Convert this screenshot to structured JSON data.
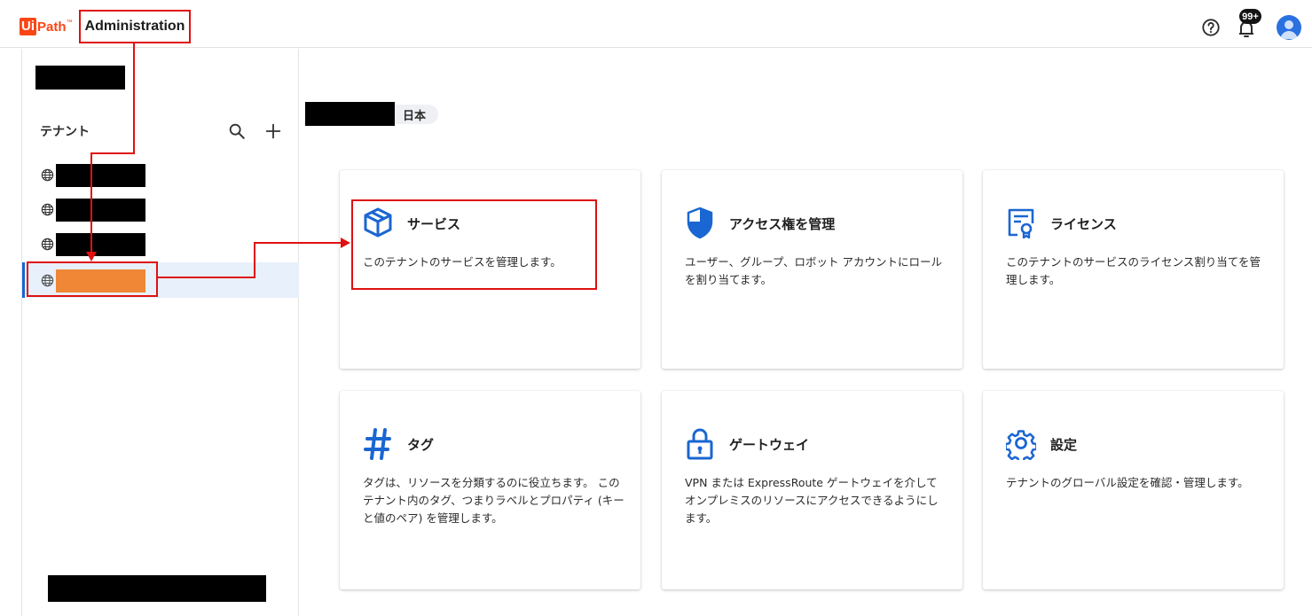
{
  "header": {
    "logo_ui": "Ui",
    "logo_path": "Path",
    "logo_mark": "™",
    "app_title": "Administration",
    "notification_badge": "99+"
  },
  "sidebar": {
    "heading": "テナント"
  },
  "main": {
    "region_label": "日本",
    "cards": [
      {
        "title": "サービス",
        "description": "このテナントのサービスを管理します。",
        "icon": "cube-icon"
      },
      {
        "title": "アクセス権を管理",
        "description": "ユーザー、グループ、ロボット アカウントにロールを割り当てます。",
        "icon": "shield-icon"
      },
      {
        "title": "ライセンス",
        "description": "このテナントのサービスのライセンス割り当てを管理します。",
        "icon": "license-certificate-icon"
      },
      {
        "title": "タグ",
        "description": "タグは、リソースを分類するのに役立ちます。 このテナント内のタグ、つまりラベルとプロパティ (キーと値のペア) を管理します。",
        "icon": "hashtag-icon"
      },
      {
        "title": "ゲートウェイ",
        "description": "VPN または ExpressRoute ゲートウェイを介してオンプレミスのリソースにアクセスできるようにします。",
        "icon": "lock-icon"
      },
      {
        "title": "設定",
        "description": "テナントのグローバル設定を確認・管理します。",
        "icon": "gear-icon"
      }
    ]
  },
  "colors": {
    "brand": "#fa4616",
    "accent": "#1a66d2",
    "annotation": "#e01010",
    "selected_tenant_highlight": "#f08736"
  }
}
